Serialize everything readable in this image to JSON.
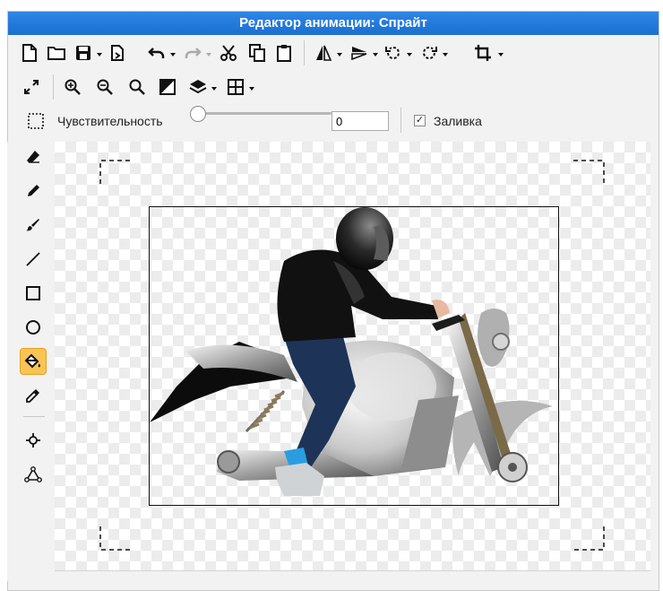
{
  "window": {
    "title": "Редактор анимации: Спрайт"
  },
  "toolbar": {
    "row1": [
      "new-file-icon",
      "open-folder-icon",
      "save-icon",
      "save-dropdown-icon",
      "export-icon",
      "undo-icon",
      "undo-dropdown-icon",
      "redo-icon",
      "redo-dropdown-icon",
      "cut-icon",
      "copy-icon",
      "paste-icon",
      "flip-horizontal-icon",
      "flip-h-dropdown-icon",
      "flip-vertical-icon",
      "flip-v-dropdown-icon",
      "rotate-left-icon",
      "rotate-left-dropdown-icon",
      "rotate-right-icon",
      "rotate-right-dropdown-icon",
      "crop-icon",
      "crop-dropdown-icon"
    ],
    "row2": [
      "fit-screen-icon",
      "zoom-in-icon",
      "zoom-out-icon",
      "zoom-reset-icon",
      "contrast-icon",
      "layers-icon",
      "layers-dropdown-icon",
      "grid-icon",
      "grid-dropdown-icon"
    ]
  },
  "options": {
    "sensitivity_label": "Чувствительность",
    "sensitivity_value": "0",
    "sensitivity_level": 0,
    "fill_label": "Заливка",
    "fill_checked": true
  },
  "tools": [
    "eraser-icon",
    "pencil-icon",
    "brush-icon",
    "line-icon",
    "rectangle-icon",
    "ellipse-icon",
    "fill-bucket-icon",
    "eyedropper-icon",
    "node-select-icon",
    "node-edit-icon"
  ],
  "active_tool": "fill-bucket-icon"
}
